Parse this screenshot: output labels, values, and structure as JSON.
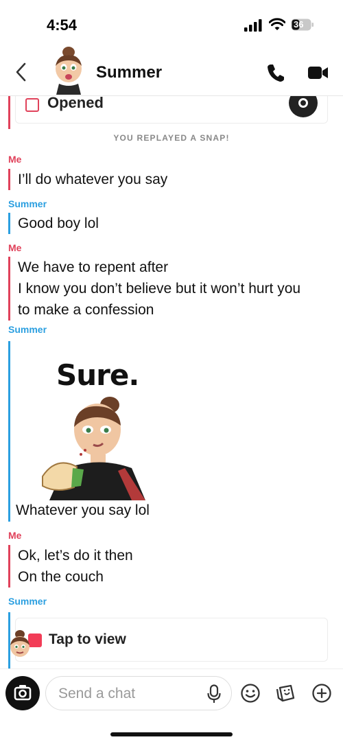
{
  "status_bar": {
    "time": "4:54",
    "battery": "36"
  },
  "header": {
    "contact_name": "Summer",
    "icons": {
      "back": "chevron-left-icon",
      "call": "phone-icon",
      "video": "video-camera-icon"
    }
  },
  "opened_card": {
    "label": "Opened"
  },
  "system_note": "YOU REPLAYED A SNAP!",
  "messages": [
    {
      "sender": "Me",
      "lines": [
        "I’ll do whatever you say"
      ]
    },
    {
      "sender": "Summer",
      "lines": [
        "Good boy lol"
      ]
    },
    {
      "sender": "Me",
      "lines": [
        "We have to repent after",
        "I know you don’t believe but it won’t hurt you",
        "to make a confession"
      ]
    },
    {
      "sender": "Summer",
      "sticker_text": "Sure.",
      "lines": [
        "Whatever you say lol"
      ]
    },
    {
      "sender": "Me",
      "lines": [
        "Ok, let’s do it then",
        "On the couch"
      ]
    },
    {
      "sender": "Summer",
      "snap": "Tap to view"
    }
  ],
  "composer": {
    "placeholder": "Send a chat",
    "icons": [
      "camera-icon",
      "microphone-icon",
      "smiley-icon",
      "sticker-icon",
      "plus-icon"
    ]
  },
  "colors": {
    "me": "#e0415a",
    "summer": "#2b9fe0",
    "snap_red": "#f23c57"
  }
}
